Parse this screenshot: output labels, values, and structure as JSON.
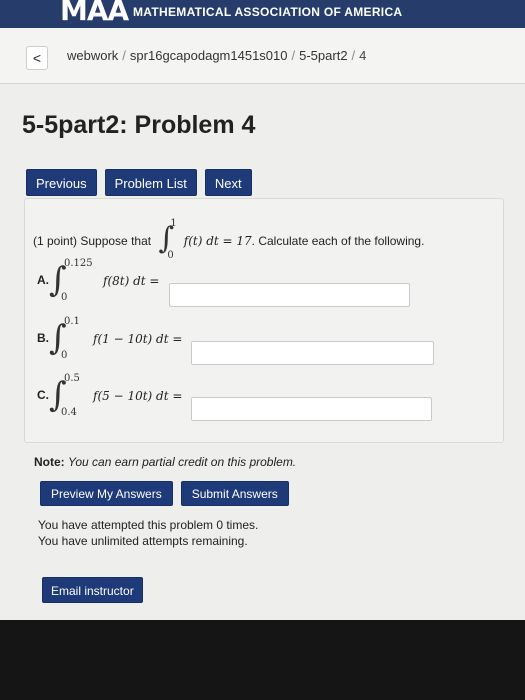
{
  "header": {
    "logo": "MAA",
    "org": "MATHEMATICAL ASSOCIATION OF AMERICA"
  },
  "breadcrumb": {
    "back": "<",
    "items": [
      "webwork",
      "spr16gcapodagm1451s010",
      "5-5part2",
      "4"
    ]
  },
  "page": {
    "title": "5-5part2: Problem 4"
  },
  "nav": {
    "previous": "Previous",
    "problem_list": "Problem List",
    "next": "Next"
  },
  "problem": {
    "points": "(1 point) Suppose that",
    "given_upper": "1",
    "given_lower": "0",
    "given_expr": "f(t) dt = 17",
    "instruction": ". Calculate each of the following.",
    "parts": [
      {
        "label": "A.",
        "upper": "0.125",
        "lower": "0",
        "expr": "f(8t) dt =",
        "value": ""
      },
      {
        "label": "B.",
        "upper": "0.1",
        "lower": "0",
        "expr": "f(1 − 10t) dt =",
        "value": ""
      },
      {
        "label": "C.",
        "upper": "0.5",
        "lower": "0.4",
        "expr": "f(5 − 10t) dt =",
        "value": ""
      }
    ]
  },
  "note": {
    "label": "Note:",
    "text": "You can earn partial credit on this problem."
  },
  "actions": {
    "preview": "Preview My Answers",
    "submit": "Submit Answers"
  },
  "attempts": {
    "line1": "You have attempted this problem 0 times.",
    "line2": "You have unlimited attempts remaining."
  },
  "email": {
    "label": "Email instructor"
  },
  "colors": {
    "header_bg": "#263d6c",
    "button_bg": "#1e3a78",
    "page_bg": "#eeeeec"
  }
}
